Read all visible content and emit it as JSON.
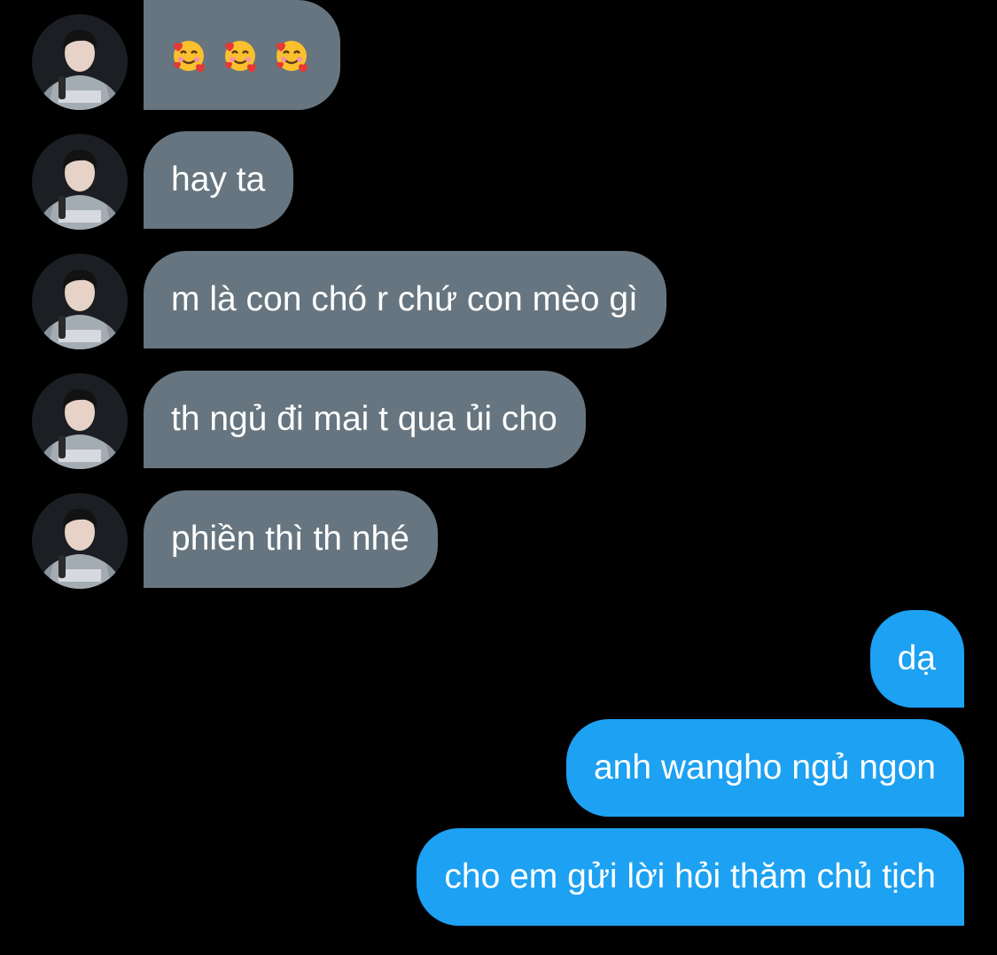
{
  "conversation": {
    "incoming": [
      {
        "text": "🥰 🥰 🥰",
        "emoji": [
          "smiling-face-with-hearts",
          "smiling-face-with-hearts",
          "smiling-face-with-hearts"
        ]
      },
      {
        "text": "hay ta"
      },
      {
        "text": "m là con chó r chứ con mèo gì"
      },
      {
        "text": "th ngủ đi mai t qua ủi cho"
      },
      {
        "text": "phiền thì th nhé"
      }
    ],
    "outgoing": [
      {
        "text": "dạ"
      },
      {
        "text": "anh wangho ngủ ngon"
      },
      {
        "text": "cho em gửi lời hỏi thăm chủ tịch"
      }
    ]
  },
  "colors": {
    "background": "#000000",
    "incoming_bubble": "#66757f",
    "outgoing_bubble": "#1da1f2",
    "text": "#ffffff"
  }
}
